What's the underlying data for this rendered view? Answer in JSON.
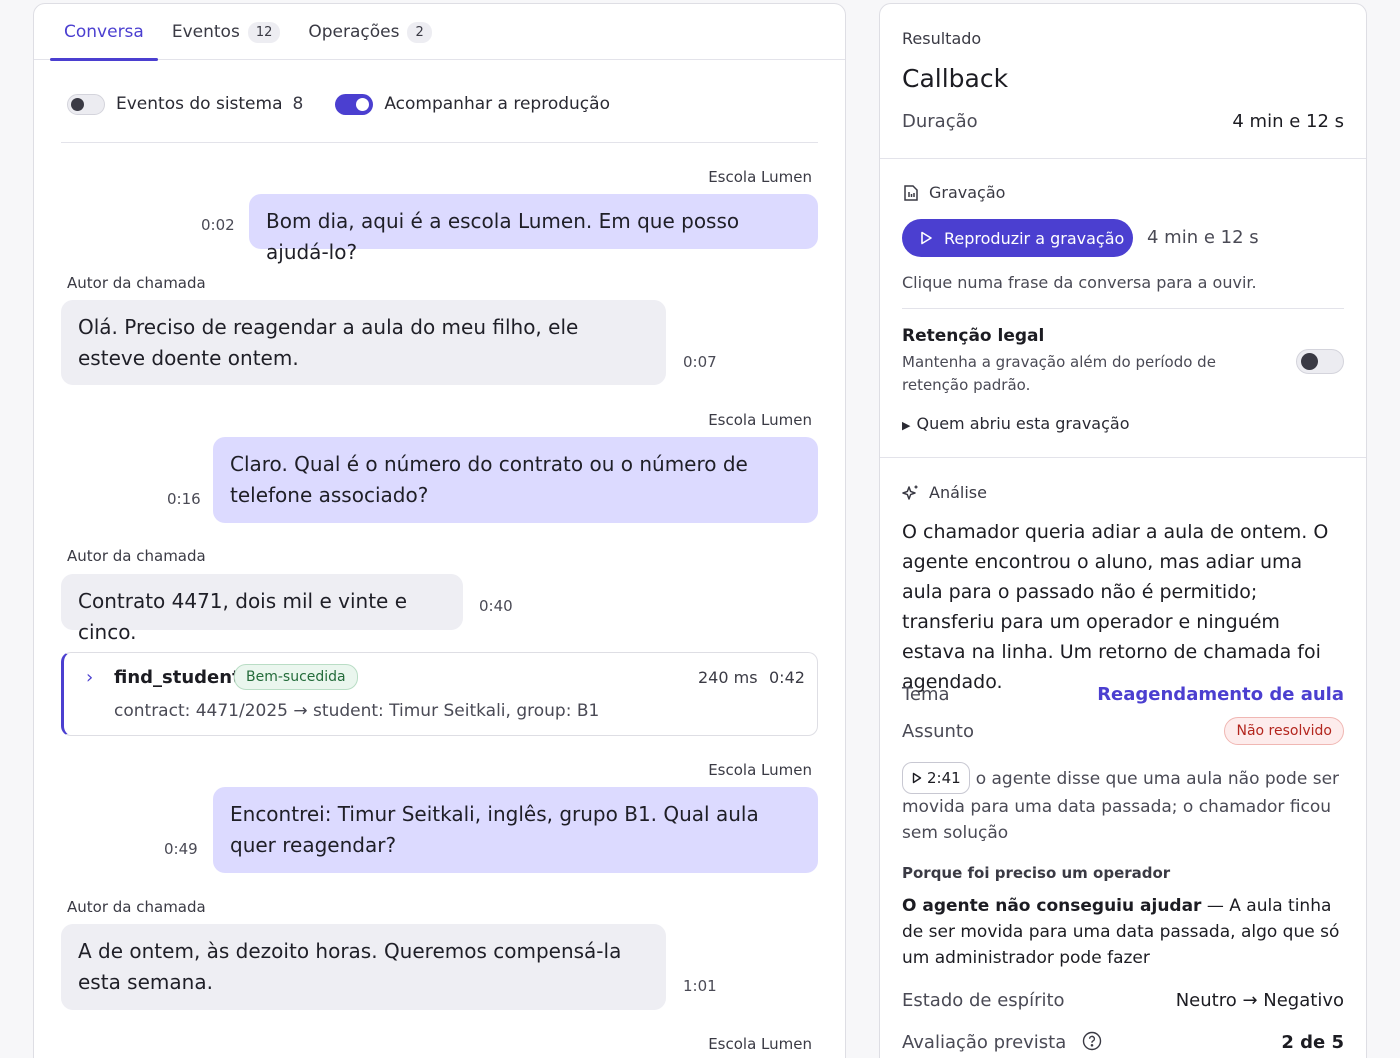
{
  "tabs": [
    {
      "label": "Conversa"
    },
    {
      "label": "Eventos",
      "count": "12"
    },
    {
      "label": "Operações",
      "count": "2"
    }
  ],
  "toggles": {
    "system_events": {
      "label": "Eventos do sistema",
      "count": "8",
      "state": "off"
    },
    "follow_playback": {
      "label": "Acompanhar a reprodução",
      "state": "on"
    }
  },
  "messages": [
    {
      "speaker": "Escola Lumen",
      "text": "Bom dia, aqui é a escola Lumen. Em que posso ajudá-lo?",
      "time": "0:02"
    },
    {
      "speaker": "Autor da chamada",
      "text": "Olá. Preciso de reagendar a aula do meu filho, ele esteve doente ontem.",
      "time": "0:07"
    },
    {
      "speaker": "Escola Lumen",
      "text": "Claro. Qual é o número do contrato ou o número de telefone associado?",
      "time": "0:16"
    },
    {
      "speaker": "Autor da chamada",
      "text": "Contrato 4471, dois mil e vinte e cinco.",
      "time": "0:40"
    },
    {
      "speaker": "Escola Lumen",
      "text": "Encontrei: Timur Seitkali, inglês, grupo B1. Qual aula quer reagendar?",
      "time": "0:49"
    },
    {
      "speaker": "Autor da chamada",
      "text": "A de ontem, às dezoito horas. Queremos compensá-la esta semana.",
      "time": "1:01"
    },
    {
      "speaker": "Escola Lumen"
    }
  ],
  "tool_call": {
    "name": "find_student",
    "status": "Bem-sucedida",
    "duration": "240 ms",
    "time": "0:42",
    "detail": "contract: 4471/2025 → student: Timur Seitkali, group: B1"
  },
  "result": {
    "label": "Resultado",
    "title": "Callback",
    "duration_label": "Duração",
    "duration_value": "4 min e 12 s"
  },
  "recording": {
    "title": "Gravação",
    "play_label": "Reproduzir a gravação",
    "length": "4 min e 12 s",
    "hint": "Clique numa frase da conversa para a ouvir.",
    "retention_title": "Retenção legal",
    "retention_desc_1": "Mantenha a gravação além do período de",
    "retention_desc_2": "retenção padrão.",
    "retention_state": "off",
    "who_opened": "Quem abriu esta gravação"
  },
  "analysis": {
    "title": "Análise",
    "summary": "O chamador queria adiar a aula de ontem. O agente encontrou o aluno, mas adiar uma aula para o passado não é permitido; transferiu para um operador e ninguém estava na linha. Um retorno de chamada foi agendado.",
    "topic_label": "Tema",
    "topic_value": "Reagendamento de aula",
    "subject_label": "Assunto",
    "subject_value": "Não resolvido",
    "moment_time": "2:41",
    "moment_text": "o agente disse que uma aula não pode ser movida para uma data passada; o chamador ficou sem solução",
    "why_operator_label": "Porque foi preciso um operador",
    "why_operator_bold": "O agente não conseguiu ajudar",
    "why_operator_text": " — A aula tinha de ser movida para uma data passada, algo que só um administrador pode fazer",
    "mood_label": "Estado de espírito",
    "mood_value": "Neutro → Negativo",
    "rating_label": "Avaliação prevista",
    "rating_value": "2 de 5"
  }
}
